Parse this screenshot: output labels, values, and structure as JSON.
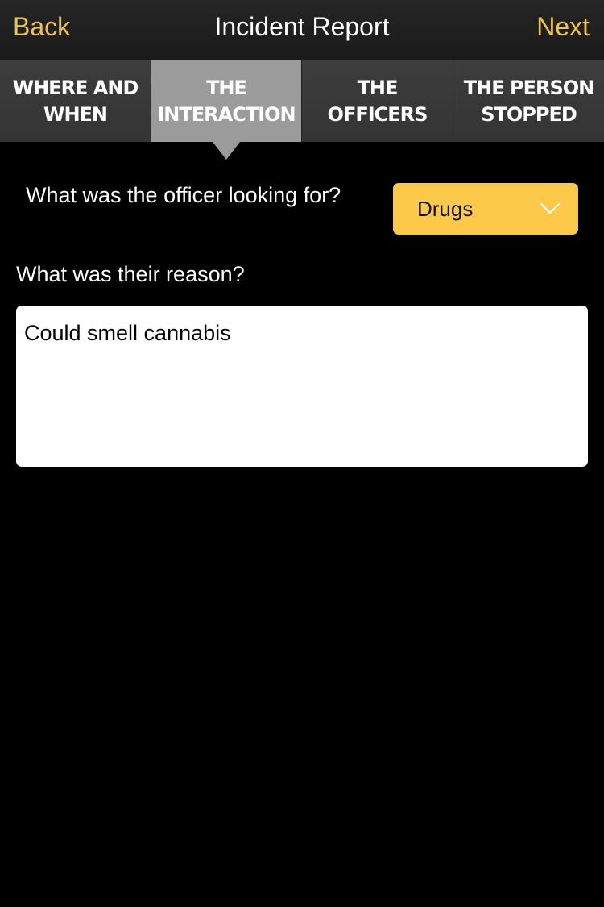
{
  "navbar": {
    "back_label": "Back",
    "title": "Incident Report",
    "next_label": "Next"
  },
  "tabs": [
    {
      "label": "WHERE AND WHEN",
      "active": false
    },
    {
      "label": "THE INTERACTION",
      "active": true
    },
    {
      "label": "THE OFFICERS",
      "active": false
    },
    {
      "label": "THE PERSON STOPPED",
      "active": false
    }
  ],
  "form": {
    "looking_for_question": "What was the officer looking for?",
    "looking_for_value": "Drugs",
    "reason_question": "What was their reason?",
    "reason_value": "Could smell cannabis"
  },
  "icons": {
    "dropdown": "chevron-down-icon"
  },
  "colors": {
    "accent": "#f0c34b",
    "select_background": "#fcc94b",
    "active_tab": "#9b9b9b",
    "background": "#000000"
  }
}
